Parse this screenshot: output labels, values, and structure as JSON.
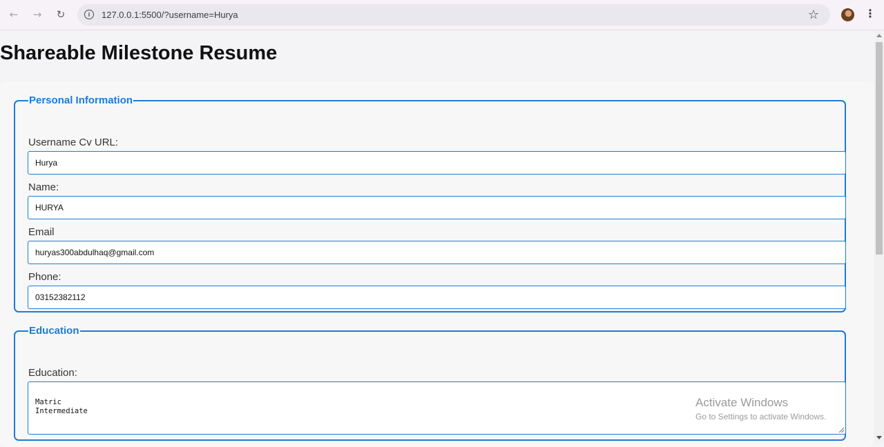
{
  "browser": {
    "url": "127.0.0.1:5500/?username=Hurya",
    "icons": {
      "back": "arrow-left",
      "forward": "arrow-right",
      "reload": "reload",
      "info": "info",
      "bookmark": "star",
      "menu": "kebab"
    }
  },
  "page": {
    "title": "Shareable Milestone Resume"
  },
  "personal": {
    "legend": "Personal Information",
    "username_label": "Username Cv URL:",
    "username_value": "Hurya",
    "name_label": "Name:",
    "name_value": "HURYA",
    "email_label": "Email",
    "email_value": "huryas300abdulhaq@gmail.com",
    "phone_label": "Phone:",
    "phone_value": "03152382112"
  },
  "education": {
    "legend": "Education",
    "label": "Education:",
    "value": "Matric\nIntermediate"
  },
  "watermark": {
    "title": "Activate Windows",
    "subtitle": "Go to Settings to activate Windows."
  },
  "colors": {
    "accent": "#1d7ad6"
  }
}
